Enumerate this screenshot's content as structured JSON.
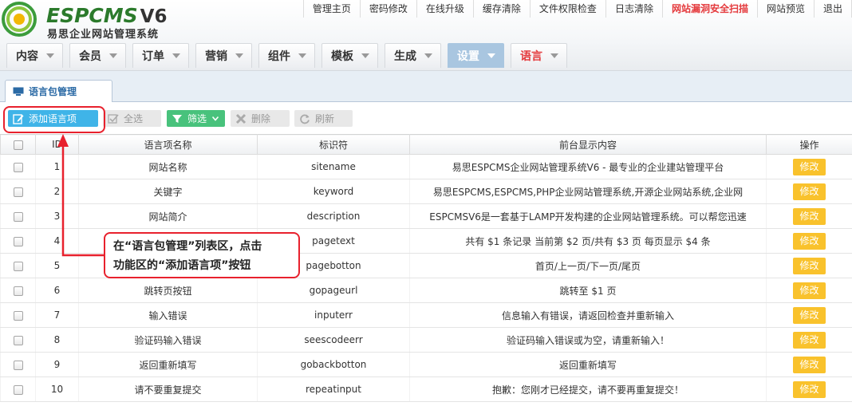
{
  "logo": {
    "brand": "ESPCMS",
    "version": "V6",
    "subtitle": "易思企业网站管理系统"
  },
  "topnav": [
    {
      "label": "管理主页",
      "hot": false
    },
    {
      "label": "密码修改",
      "hot": false
    },
    {
      "label": "在线升级",
      "hot": false
    },
    {
      "label": "缓存清除",
      "hot": false
    },
    {
      "label": "文件权限检查",
      "hot": false
    },
    {
      "label": "日志清除",
      "hot": false
    },
    {
      "label": "网站漏洞安全扫描",
      "hot": true
    },
    {
      "label": "网站预览",
      "hot": false
    },
    {
      "label": "退出",
      "hot": false
    }
  ],
  "mainnav": [
    "内容",
    "会员",
    "订单",
    "营销",
    "组件",
    "模板",
    "生成",
    "设置",
    "语言"
  ],
  "subtab": {
    "label": "语言包管理"
  },
  "toolbar": {
    "add": "添加语言项",
    "select_all": "全选",
    "filter": "筛选",
    "delete": "删除",
    "refresh": "刷新"
  },
  "table": {
    "headers": {
      "id": "ID",
      "name": "语言项名称",
      "key": "标识符",
      "display": "前台显示内容",
      "action": "操作"
    },
    "edit_label": "修改",
    "rows": [
      {
        "id": "1",
        "name": "网站名称",
        "key": "sitename",
        "display": "易思ESPCMS企业网站管理系统V6 - 最专业的企业建站管理平台"
      },
      {
        "id": "2",
        "name": "关键字",
        "key": "keyword",
        "display": "易思ESPCMS,ESPCMS,PHP企业网站管理系统,开源企业网站系统,企业网"
      },
      {
        "id": "3",
        "name": "网站简介",
        "key": "description",
        "display": "ESPCMSV6是一套基于LAMP开发构建的企业网站管理系统。可以帮您迅速"
      },
      {
        "id": "4",
        "name": "",
        "key": "pagetext",
        "display": "共有 $1 条记录 当前第 $2 页/共有 $3 页 每页显示 $4 条"
      },
      {
        "id": "5",
        "name": "",
        "key": "pagebotton",
        "display": "首页/上一页/下一页/尾页"
      },
      {
        "id": "6",
        "name": "跳转页按钮",
        "key": "gopageurl",
        "display": "跳转至 $1 页"
      },
      {
        "id": "7",
        "name": "输入错误",
        "key": "inputerr",
        "display": "信息输入有错误，请返回检查并重新输入"
      },
      {
        "id": "8",
        "name": "验证码输入错误",
        "key": "seescodeerr",
        "display": "验证码输入错误或为空，请重新输入！"
      },
      {
        "id": "9",
        "name": "返回重新填写",
        "key": "gobackbotton",
        "display": "返回重新填写"
      },
      {
        "id": "10",
        "name": "请不要重复提交",
        "key": "repeatinput",
        "display": "抱歉：您刚才已经提交，请不要再重复提交！"
      }
    ]
  },
  "annotation": {
    "line1": "在“语言包管理”列表区，点击",
    "line2": "功能区的“添加语言项”按钮"
  },
  "colors": {
    "add_button": "#3fb4e8",
    "filter_button": "#48c27c",
    "edit_button": "#f9c22c",
    "highlight": "#e8212d",
    "hot_link": "#e4393c",
    "active_tab": "#a9c6e0"
  }
}
